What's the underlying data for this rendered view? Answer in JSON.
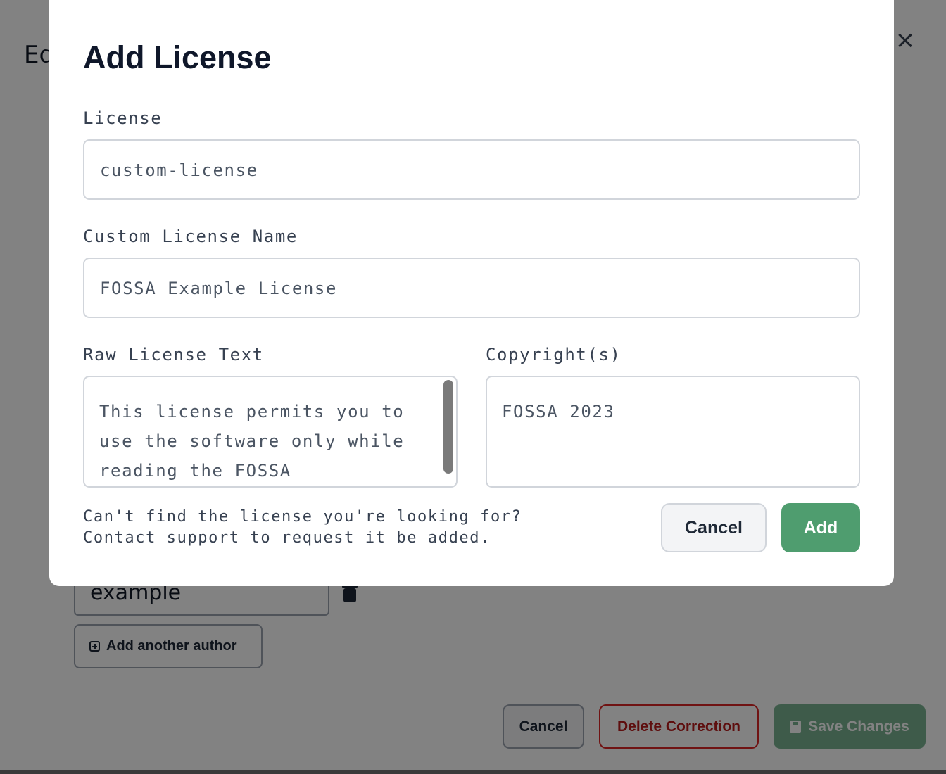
{
  "background": {
    "title": "Ed",
    "close_icon": "close-icon",
    "author_value": "example",
    "add_author_label": "Add another author",
    "cancel_label": "Cancel",
    "delete_label": "Delete Correction",
    "save_label": "Save Changes"
  },
  "modal": {
    "title": "Add License",
    "license_label": "License",
    "license_value": "custom-license",
    "custom_name_label": "Custom License Name",
    "custom_name_value": "FOSSA Example License",
    "raw_text_label": "Raw License Text",
    "raw_text_value": "This license permits you to use the software only while reading the FOSSA documentation",
    "copyright_label": "Copyright(s)",
    "copyright_value": "FOSSA 2023",
    "help_line1": "Can't find the license you're looking for?",
    "help_line2": "Contact support to request it be added.",
    "cancel_label": "Cancel",
    "add_label": "Add"
  },
  "colors": {
    "accent_green": "#4f9d6f",
    "danger_red": "#b91c1c",
    "overlay": "rgba(0,0,0,0.49)"
  }
}
